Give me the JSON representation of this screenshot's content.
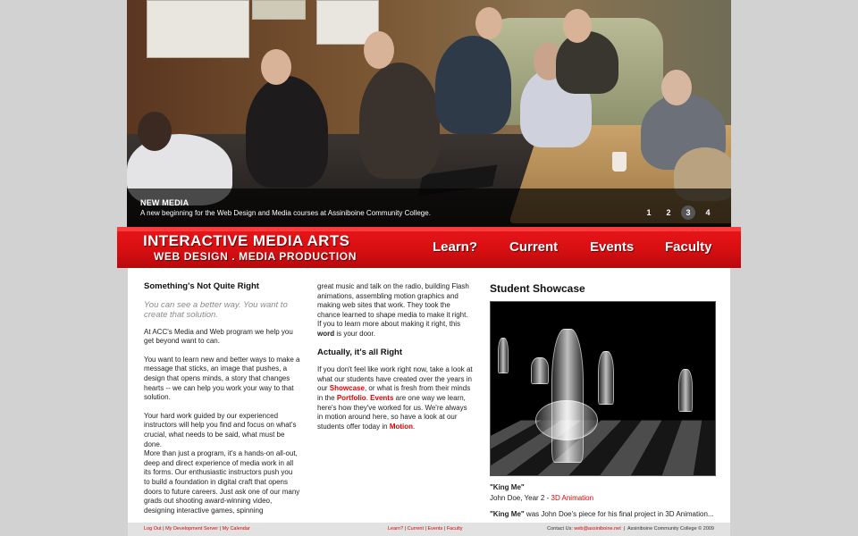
{
  "hero": {
    "caption_title": "NEW MEDIA",
    "caption_text": "A new beginning for the Web Design and Media courses at Assiniboine Community College.",
    "slides": [
      "1",
      "2",
      "3",
      "4"
    ],
    "active_slide": "3"
  },
  "header": {
    "logo_line1": "INTERACTIVE MEDIA ARTS",
    "logo_line2": "WEB DESIGN . MEDIA PRODUCTION",
    "nav": [
      "Learn?",
      "Current",
      "Events",
      "Faculty"
    ]
  },
  "col1": {
    "heading": "Something's Not Quite Right",
    "subtitle": "You can see a better way. You want to create that solution.",
    "p1": "At ACC's Media and Web program we help you get beyond want to can.",
    "p2": "You want to learn new and better ways to make a message that sticks, an image that pushes, a design that opens minds, a story that changes hearts -- we can help you work your way to that solution.",
    "p3": "Your hard work guided by our experienced instructors will help you find and focus on what's crucial, what needs to be said, what must be done.",
    "p4": "More than just a program, it's a hands-on all-out, deep and direct experience of media work in all its forms. Our enthusiastic instructors push you to build a foundation in digital craft that opens doors to future careers. Just ask one of our many grads out shooting award-winning video, designing interactive games, spinning"
  },
  "col2": {
    "p1a": "great music and talk on the radio, building Flash animations, assembling motion graphics and making web sites that work. They took the chance learned to shape media to make it right. If you to learn more about making it right, this",
    "p1_word": "word",
    "p1b": "is your door.",
    "heading": "Actually, it's all Right",
    "p2a": "If you don't feel like work right now, take a look at what our students have created over the years in our",
    "link_showcase": "Showcase",
    "p2b": ", or what is fresh from their minds in the",
    "link_portfolio": "Portfolio",
    "p2c": ".",
    "link_events": "Events",
    "p2d": "are one way we learn, here's how they've worked for us. We're always in motion around here, so have a look at our students offer today in",
    "link_motion": "Motion",
    "p2e": "."
  },
  "showcase": {
    "title": "Student Showcase",
    "item_title": "\"King Me\"",
    "item_author": "John Doe, Year 2 - ",
    "item_category": "3D Animation",
    "desc_title": "\"King Me\"",
    "desc_text": " was John Doe's piece for his final project in 3D Animation..."
  },
  "footer": {
    "left_links": [
      "Log Out",
      "My Development Server",
      "My Calendar"
    ],
    "mid_links": [
      "Learn?",
      "Current",
      "Events",
      "Faculty"
    ],
    "contact_label": "Contact Us:",
    "contact_email": "web@assiniboine.net",
    "copyright": "Assiniboine Community College © 2009"
  },
  "colors": {
    "accent": "#e30000",
    "band": "#d80f12",
    "background": "#d2d2d2"
  }
}
